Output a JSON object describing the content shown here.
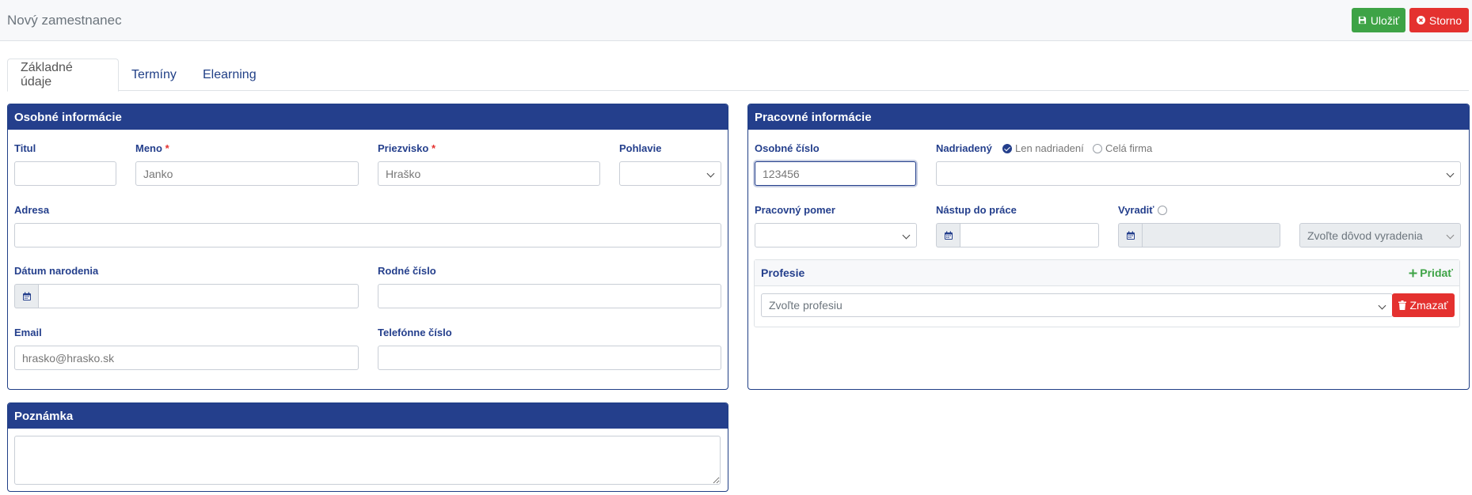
{
  "header": {
    "title": "Nový zamestnanec",
    "save_label": "Uložiť",
    "cancel_label": "Storno"
  },
  "tabs": [
    {
      "label": "Základné údaje",
      "active": true
    },
    {
      "label": "Termíny",
      "active": false
    },
    {
      "label": "Elearning",
      "active": false
    }
  ],
  "personal": {
    "title": "Osobné informácie",
    "titul_label": "Titul",
    "titul_value": "",
    "meno_label": "Meno",
    "meno_placeholder": "Janko",
    "priezvisko_label": "Priezvisko",
    "priezvisko_placeholder": "Hraško",
    "required_mark": "*",
    "pohlavie_label": "Pohlavie",
    "pohlavie_value": "",
    "adresa_label": "Adresa",
    "datum_label": "Dátum narodenia",
    "rodne_label": "Rodné číslo",
    "email_label": "Email",
    "email_placeholder": "hrasko@hrasko.sk",
    "telefon_label": "Telefónne číslo"
  },
  "work": {
    "title": "Pracovné informácie",
    "osobne_cislo_label": "Osobné číslo",
    "osobne_cislo_placeholder": "123456",
    "nadriadeny_label": "Nadriadený",
    "radio_len": "Len nadriadení",
    "radio_cela": "Celá firma",
    "pomer_label": "Pracovný pomer",
    "nastup_label": "Nástup do práce",
    "vyradit_label": "Vyradiť",
    "dovod_placeholder": "Zvoľte dôvod vyradenia",
    "profesie_title": "Profesie",
    "pridat_label": "Pridať",
    "profesia_placeholder": "Zvoľte profesiu",
    "zmazat_label": "Zmazať"
  },
  "note": {
    "title": "Poznámka"
  },
  "colors": {
    "primary": "#243f8c",
    "success": "#3ea346",
    "danger": "#e4312f"
  }
}
